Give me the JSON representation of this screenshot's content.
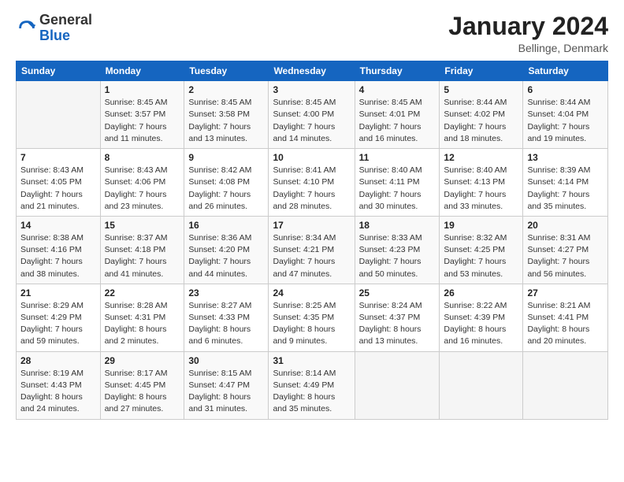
{
  "header": {
    "logo_general": "General",
    "logo_blue": "Blue",
    "month_title": "January 2024",
    "location": "Bellinge, Denmark"
  },
  "days_of_week": [
    "Sunday",
    "Monday",
    "Tuesday",
    "Wednesday",
    "Thursday",
    "Friday",
    "Saturday"
  ],
  "weeks": [
    [
      {
        "day": "",
        "sunrise": "",
        "sunset": "",
        "daylight": ""
      },
      {
        "day": "1",
        "sunrise": "Sunrise: 8:45 AM",
        "sunset": "Sunset: 3:57 PM",
        "daylight": "Daylight: 7 hours and 11 minutes."
      },
      {
        "day": "2",
        "sunrise": "Sunrise: 8:45 AM",
        "sunset": "Sunset: 3:58 PM",
        "daylight": "Daylight: 7 hours and 13 minutes."
      },
      {
        "day": "3",
        "sunrise": "Sunrise: 8:45 AM",
        "sunset": "Sunset: 4:00 PM",
        "daylight": "Daylight: 7 hours and 14 minutes."
      },
      {
        "day": "4",
        "sunrise": "Sunrise: 8:45 AM",
        "sunset": "Sunset: 4:01 PM",
        "daylight": "Daylight: 7 hours and 16 minutes."
      },
      {
        "day": "5",
        "sunrise": "Sunrise: 8:44 AM",
        "sunset": "Sunset: 4:02 PM",
        "daylight": "Daylight: 7 hours and 18 minutes."
      },
      {
        "day": "6",
        "sunrise": "Sunrise: 8:44 AM",
        "sunset": "Sunset: 4:04 PM",
        "daylight": "Daylight: 7 hours and 19 minutes."
      }
    ],
    [
      {
        "day": "7",
        "sunrise": "Sunrise: 8:43 AM",
        "sunset": "Sunset: 4:05 PM",
        "daylight": "Daylight: 7 hours and 21 minutes."
      },
      {
        "day": "8",
        "sunrise": "Sunrise: 8:43 AM",
        "sunset": "Sunset: 4:06 PM",
        "daylight": "Daylight: 7 hours and 23 minutes."
      },
      {
        "day": "9",
        "sunrise": "Sunrise: 8:42 AM",
        "sunset": "Sunset: 4:08 PM",
        "daylight": "Daylight: 7 hours and 26 minutes."
      },
      {
        "day": "10",
        "sunrise": "Sunrise: 8:41 AM",
        "sunset": "Sunset: 4:10 PM",
        "daylight": "Daylight: 7 hours and 28 minutes."
      },
      {
        "day": "11",
        "sunrise": "Sunrise: 8:40 AM",
        "sunset": "Sunset: 4:11 PM",
        "daylight": "Daylight: 7 hours and 30 minutes."
      },
      {
        "day": "12",
        "sunrise": "Sunrise: 8:40 AM",
        "sunset": "Sunset: 4:13 PM",
        "daylight": "Daylight: 7 hours and 33 minutes."
      },
      {
        "day": "13",
        "sunrise": "Sunrise: 8:39 AM",
        "sunset": "Sunset: 4:14 PM",
        "daylight": "Daylight: 7 hours and 35 minutes."
      }
    ],
    [
      {
        "day": "14",
        "sunrise": "Sunrise: 8:38 AM",
        "sunset": "Sunset: 4:16 PM",
        "daylight": "Daylight: 7 hours and 38 minutes."
      },
      {
        "day": "15",
        "sunrise": "Sunrise: 8:37 AM",
        "sunset": "Sunset: 4:18 PM",
        "daylight": "Daylight: 7 hours and 41 minutes."
      },
      {
        "day": "16",
        "sunrise": "Sunrise: 8:36 AM",
        "sunset": "Sunset: 4:20 PM",
        "daylight": "Daylight: 7 hours and 44 minutes."
      },
      {
        "day": "17",
        "sunrise": "Sunrise: 8:34 AM",
        "sunset": "Sunset: 4:21 PM",
        "daylight": "Daylight: 7 hours and 47 minutes."
      },
      {
        "day": "18",
        "sunrise": "Sunrise: 8:33 AM",
        "sunset": "Sunset: 4:23 PM",
        "daylight": "Daylight: 7 hours and 50 minutes."
      },
      {
        "day": "19",
        "sunrise": "Sunrise: 8:32 AM",
        "sunset": "Sunset: 4:25 PM",
        "daylight": "Daylight: 7 hours and 53 minutes."
      },
      {
        "day": "20",
        "sunrise": "Sunrise: 8:31 AM",
        "sunset": "Sunset: 4:27 PM",
        "daylight": "Daylight: 7 hours and 56 minutes."
      }
    ],
    [
      {
        "day": "21",
        "sunrise": "Sunrise: 8:29 AM",
        "sunset": "Sunset: 4:29 PM",
        "daylight": "Daylight: 7 hours and 59 minutes."
      },
      {
        "day": "22",
        "sunrise": "Sunrise: 8:28 AM",
        "sunset": "Sunset: 4:31 PM",
        "daylight": "Daylight: 8 hours and 2 minutes."
      },
      {
        "day": "23",
        "sunrise": "Sunrise: 8:27 AM",
        "sunset": "Sunset: 4:33 PM",
        "daylight": "Daylight: 8 hours and 6 minutes."
      },
      {
        "day": "24",
        "sunrise": "Sunrise: 8:25 AM",
        "sunset": "Sunset: 4:35 PM",
        "daylight": "Daylight: 8 hours and 9 minutes."
      },
      {
        "day": "25",
        "sunrise": "Sunrise: 8:24 AM",
        "sunset": "Sunset: 4:37 PM",
        "daylight": "Daylight: 8 hours and 13 minutes."
      },
      {
        "day": "26",
        "sunrise": "Sunrise: 8:22 AM",
        "sunset": "Sunset: 4:39 PM",
        "daylight": "Daylight: 8 hours and 16 minutes."
      },
      {
        "day": "27",
        "sunrise": "Sunrise: 8:21 AM",
        "sunset": "Sunset: 4:41 PM",
        "daylight": "Daylight: 8 hours and 20 minutes."
      }
    ],
    [
      {
        "day": "28",
        "sunrise": "Sunrise: 8:19 AM",
        "sunset": "Sunset: 4:43 PM",
        "daylight": "Daylight: 8 hours and 24 minutes."
      },
      {
        "day": "29",
        "sunrise": "Sunrise: 8:17 AM",
        "sunset": "Sunset: 4:45 PM",
        "daylight": "Daylight: 8 hours and 27 minutes."
      },
      {
        "day": "30",
        "sunrise": "Sunrise: 8:15 AM",
        "sunset": "Sunset: 4:47 PM",
        "daylight": "Daylight: 8 hours and 31 minutes."
      },
      {
        "day": "31",
        "sunrise": "Sunrise: 8:14 AM",
        "sunset": "Sunset: 4:49 PM",
        "daylight": "Daylight: 8 hours and 35 minutes."
      },
      {
        "day": "",
        "sunrise": "",
        "sunset": "",
        "daylight": ""
      },
      {
        "day": "",
        "sunrise": "",
        "sunset": "",
        "daylight": ""
      },
      {
        "day": "",
        "sunrise": "",
        "sunset": "",
        "daylight": ""
      }
    ]
  ]
}
